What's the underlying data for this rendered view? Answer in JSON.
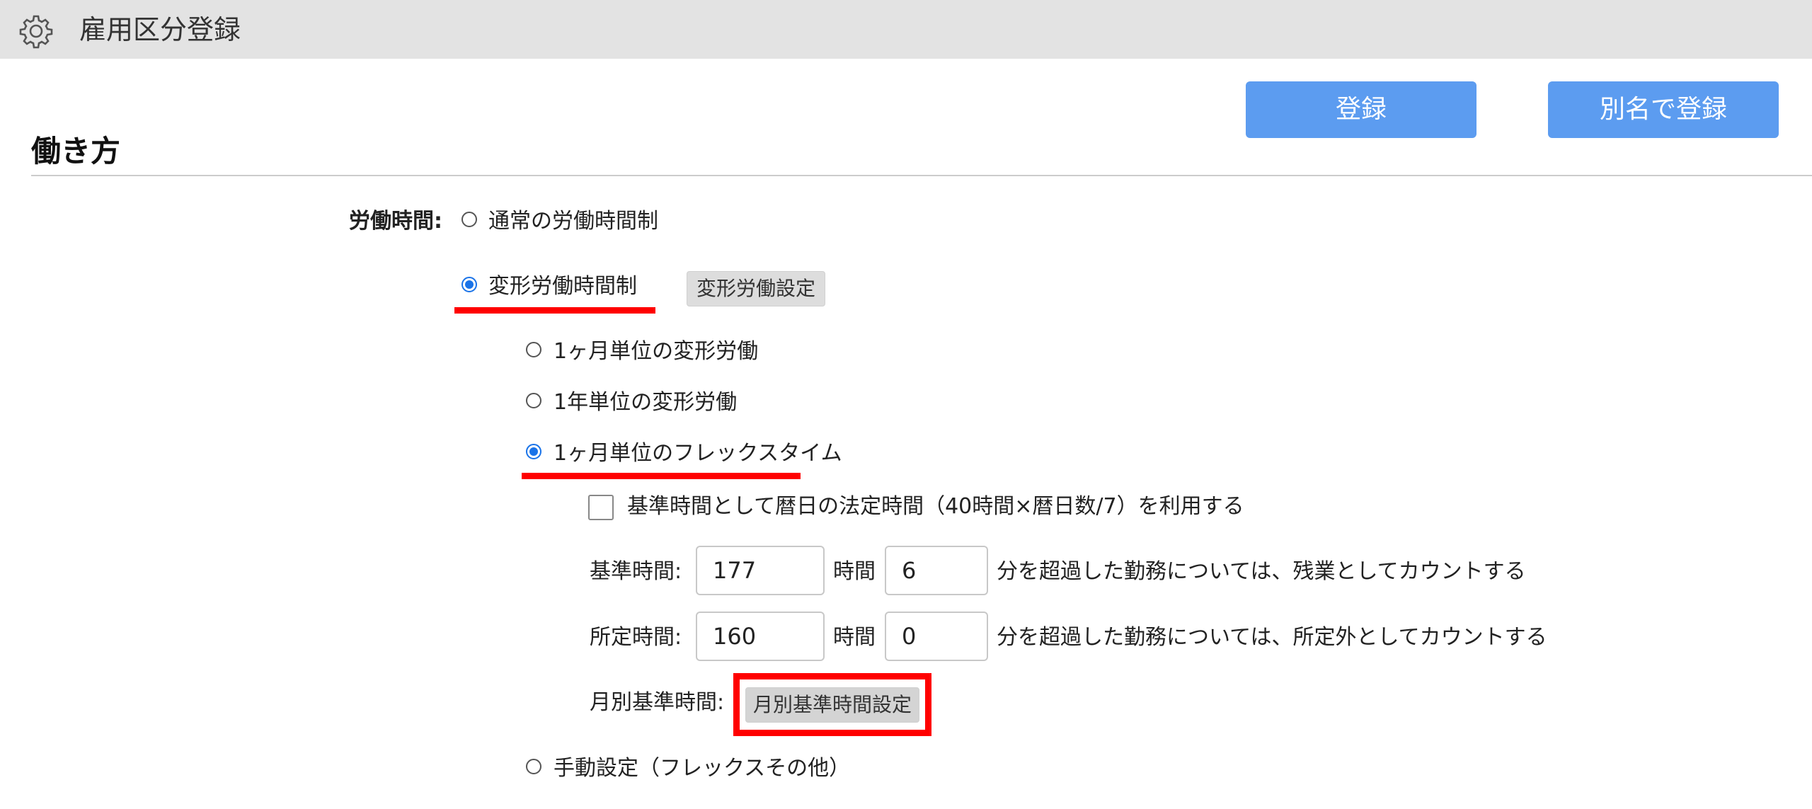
{
  "window": {
    "title": "雇用区分登録",
    "icon": "gear-icon"
  },
  "toolbar": {
    "register_label": "登録",
    "register_alias_label": "別名で登録"
  },
  "section": {
    "heading": "働き方"
  },
  "working_hours": {
    "label": "労働時間:",
    "options": {
      "normal": {
        "label": "通常の労働時間制",
        "checked": false
      },
      "variable": {
        "label": "変形労働時間制",
        "checked": true,
        "settings_button": "変形労働設定"
      },
      "manual": {
        "label": "手動設定（フレックスその他）",
        "checked": false
      }
    },
    "variable_options": {
      "one_month": {
        "label": "1ヶ月単位の変形労働",
        "checked": false
      },
      "one_year": {
        "label": "1年単位の変形労働",
        "checked": false
      },
      "flex_one_month": {
        "label": "1ヶ月単位のフレックスタイム",
        "checked": true
      }
    }
  },
  "flex": {
    "use_calendar_legal_hours": {
      "label": "基準時間として暦日の法定時間（40時間×暦日数/7）を利用する",
      "checked": false
    },
    "base_time": {
      "label": "基準時間:",
      "hours": "177",
      "hours_unit": "時間",
      "minutes": "6",
      "suffix": "分を超過した勤務については、残業としてカウントする"
    },
    "scheduled_time": {
      "label": "所定時間:",
      "hours": "160",
      "hours_unit": "時間",
      "minutes": "0",
      "suffix": "分を超過した勤務については、所定外としてカウントする"
    },
    "monthly_base": {
      "label": "月別基準時間:",
      "button": "月別基準時間設定"
    }
  },
  "colors": {
    "title_bar": "#e3e3e3",
    "primary_button": "#5c9cf0",
    "highlight": "#ff0000",
    "radio_checked": "#1a73e8"
  }
}
